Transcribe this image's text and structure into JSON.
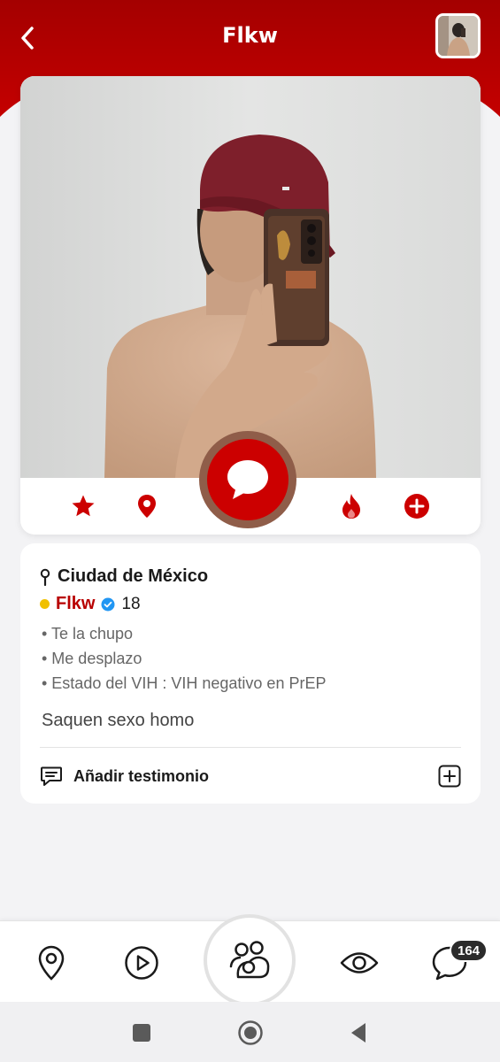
{
  "header": {
    "title": "Flkw",
    "back_icon": "chevron-left-icon",
    "avatar": "profile-thumbnail",
    "color": "#b80000"
  },
  "profile_actions": {
    "favorite_icon": "star-icon",
    "location_icon": "map-pin-icon",
    "chat_icon": "chat-bubble-icon",
    "hot_icon": "flame-icon",
    "add_icon": "plus-circle-icon",
    "accent_color": "#cc0000"
  },
  "info": {
    "location": "Ciudad de México",
    "name": "Flkw",
    "verified_icon": "verified-badge-icon",
    "online_status_color": "#f0c000",
    "age": "18",
    "bullets": [
      "• Te la chupo",
      "• Me desplazo",
      "• Estado del VIH : VIH negativo en PrEP"
    ],
    "description": "Saquen sexo homo",
    "testimonial_label": "Añadir testimonio"
  },
  "bottom_nav": {
    "items": [
      "map-pin-icon",
      "play-circle-icon",
      "users-icon",
      "eye-icon",
      "chat-icon"
    ],
    "badge": "164"
  },
  "system_nav": [
    "recents-square-icon",
    "home-circle-icon",
    "back-triangle-icon"
  ]
}
